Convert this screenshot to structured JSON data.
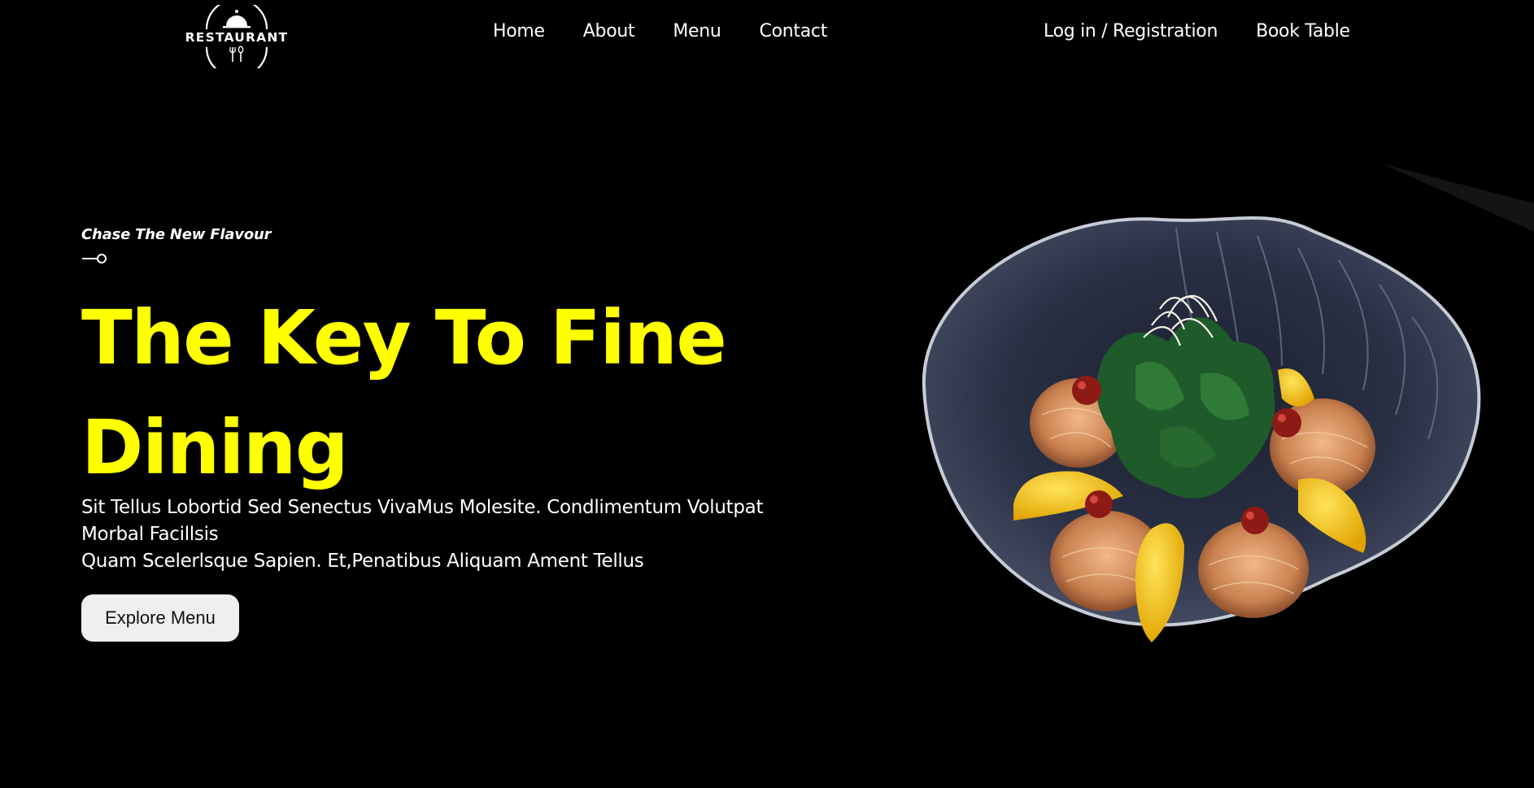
{
  "brand": {
    "logo_text": "RESTAURANT",
    "logo_icon": "cloche-fork-spoon-icon"
  },
  "nav": {
    "main": [
      {
        "label": "Home"
      },
      {
        "label": "About"
      },
      {
        "label": "Menu"
      },
      {
        "label": "Contact"
      }
    ],
    "right": [
      {
        "label": "Log in / Registration"
      },
      {
        "label": "Book Table"
      }
    ]
  },
  "hero": {
    "tagline": "Chase The New Flavour",
    "tagline_icon": "key-icon",
    "headline": "The Key To Fine Dining",
    "description_lines": [
      "Sit Tellus Lobortid Sed Senectus VivaMus Molesite. Condlimentum Volutpat Morbal Facillsis",
      "Quam Scelerlsque Sapien. Et,Penatibus Aliquam Ament Tellus"
    ],
    "cta_label": "Explore Menu",
    "image": "plated-dish-image"
  },
  "colors": {
    "background": "#000000",
    "accent": "#ffff00",
    "text": "#ffffff",
    "button_bg": "#efefef"
  }
}
